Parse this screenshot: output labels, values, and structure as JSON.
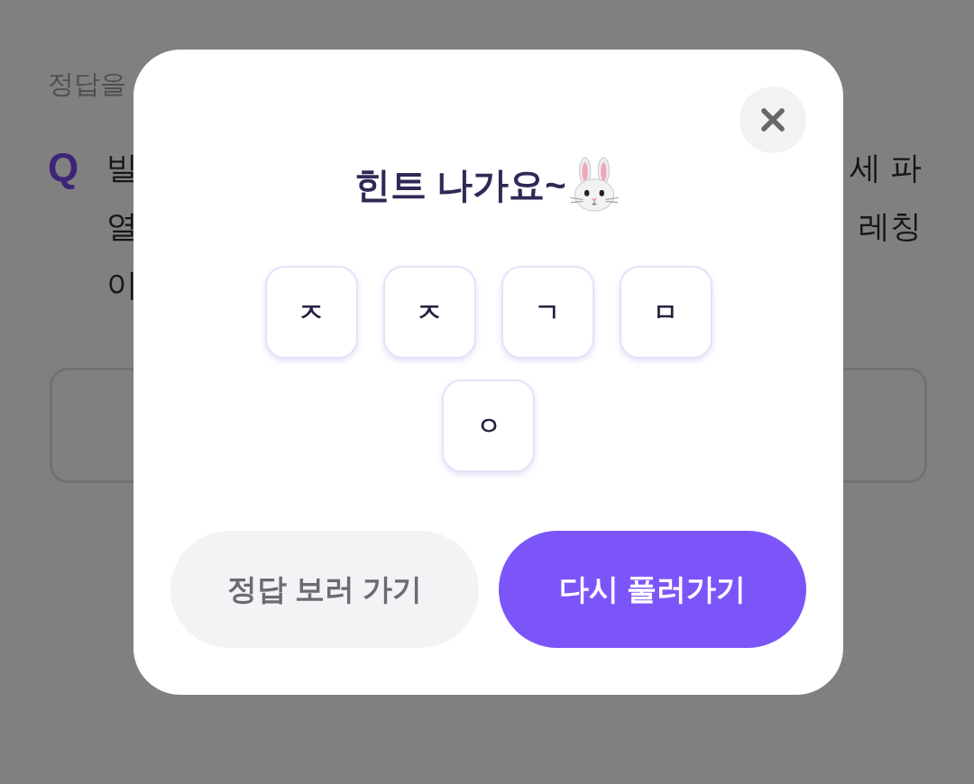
{
  "page": {
    "prompt": "정답을",
    "question_mark": "Q",
    "question_lines": [
      {
        "left": "빌",
        "right": "세 파"
      },
      {
        "left": "열",
        "right": "레칭"
      },
      {
        "left": "이"
      }
    ]
  },
  "modal": {
    "title": "힌트 나가요~",
    "hint_letters": [
      "ㅈ",
      "ㅈ",
      "ㄱ",
      "ㅁ",
      "ㅇ"
    ],
    "buttons": [
      {
        "label": "정답 보러 가기",
        "kind": "secondary"
      },
      {
        "label": "다시 풀러가기",
        "kind": "primary"
      }
    ]
  }
}
